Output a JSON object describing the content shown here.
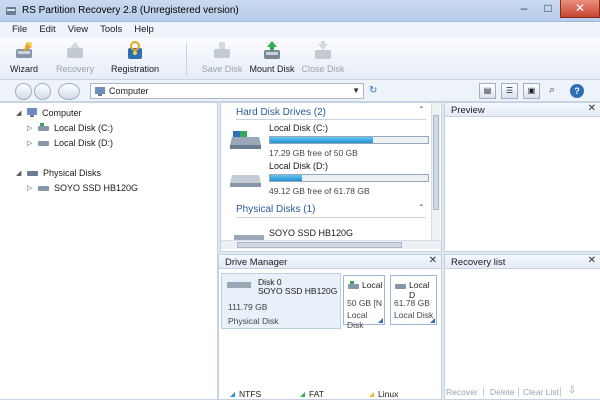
{
  "window": {
    "title": "RS Partition Recovery 2.8 (Unregistered version)"
  },
  "menu": [
    "File",
    "Edit",
    "View",
    "Tools",
    "Help"
  ],
  "toolbar": {
    "wizard": "Wizard",
    "recovery": "Recovery",
    "registration": "Registration",
    "save_disk": "Save Disk",
    "mount_disk": "Mount Disk",
    "close_disk": "Close Disk"
  },
  "address": {
    "value": "Computer"
  },
  "tree": {
    "computer": "Computer",
    "local_c": "Local Disk (C:)",
    "local_d": "Local Disk (D:)",
    "physical": "Physical Disks",
    "ssd": "SOYO SSD HB120G"
  },
  "main": {
    "hdd_heading": "Hard Disk Drives (2)",
    "drives": [
      {
        "name": "Local Disk (C:)",
        "free": "17.29 GB free of 50 GB",
        "used_fraction": 0.654
      },
      {
        "name": "Local Disk (D:)",
        "free": "49.12 GB free of 61.78 GB",
        "used_fraction": 0.205
      }
    ],
    "phys_heading": "Physical Disks (1)",
    "phys_disk": "SOYO SSD HB120G"
  },
  "preview": {
    "title": "Preview"
  },
  "drive_manager": {
    "title": "Drive Manager",
    "disk_label": "Disk 0",
    "disk_model": "SOYO SSD HB120G",
    "disk_size": "111.79 GB",
    "disk_type": "Physical Disk",
    "parts": [
      {
        "name": "Local",
        "size": "50 GB [N",
        "type": "Local Disk"
      },
      {
        "name": "Local D",
        "size": "61.78 GB",
        "type": "Local Disk"
      }
    ],
    "legend": [
      "NTFS",
      "FAT",
      "Linux"
    ]
  },
  "recovery_list": {
    "title": "Recovery list",
    "recover": "Recover",
    "delete": "Delete",
    "clear": "Clear List"
  },
  "colors": {
    "ntfs": "#2d8fd6",
    "fat": "#2eae4a",
    "linux": "#e2c21f",
    "bar_fill": "#1f8fd1"
  }
}
